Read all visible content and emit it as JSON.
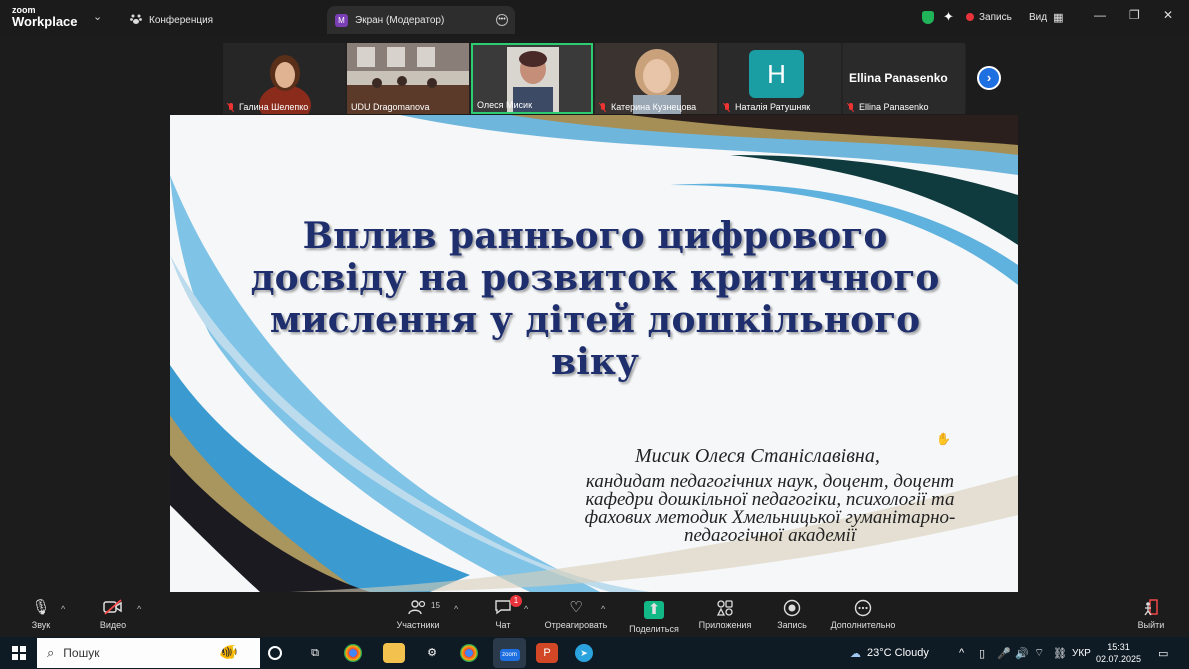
{
  "titlebar": {
    "brand_top": "zoom",
    "brand_bottom": "Workplace",
    "tab_conference": "Конференция",
    "tab_screen_badge": "M",
    "tab_screen": "Экран (Модератор)",
    "record_label": "Запись",
    "view_label": "Вид"
  },
  "gallery": {
    "participants": [
      {
        "name": "Галина Шелепко",
        "muted": true
      },
      {
        "name": "UDU Dragomanova",
        "muted": false
      },
      {
        "name": "Олеся Мисик",
        "muted": false,
        "active": true
      },
      {
        "name": "Катерина Кузнецова",
        "muted": true
      },
      {
        "name": "Наталія Ратушняк",
        "muted": true,
        "avatar_letter": "H"
      },
      {
        "name": "Ellina Panasenko",
        "muted": true,
        "big_name": "Ellina Panasenko"
      }
    ]
  },
  "slide": {
    "title": "Вплив раннього цифрового досвіду на розвиток критичного мислення у дітей дошкільного віку",
    "author_name": "Мисик Олеся Станіславівна,",
    "author_desc": "кандидат педагогічних наук, доцент, доцент кафедри дошкільної педагогіки, психології та фахових методик Хмельницької гуманітарно-педагогічної академії"
  },
  "toolbar": {
    "audio": "Звук",
    "video": "Видео",
    "participants": "Участники",
    "participants_count": "15",
    "chat": "Чат",
    "chat_badge": "1",
    "react": "Отреагировать",
    "share": "Поделиться",
    "apps": "Приложения",
    "record": "Запись",
    "more": "Дополнительно",
    "leave": "Выйти"
  },
  "taskbar": {
    "search_placeholder": "Пошук",
    "weather": "23°C  Cloudy",
    "lang": "УКР",
    "time": "15:31",
    "date": "02.07.2025"
  },
  "colors": {
    "accent_green": "#2ecc71",
    "zoom_blue": "#1e6fe0",
    "share_green": "#12b886",
    "title_navy": "#1f2f6e"
  }
}
